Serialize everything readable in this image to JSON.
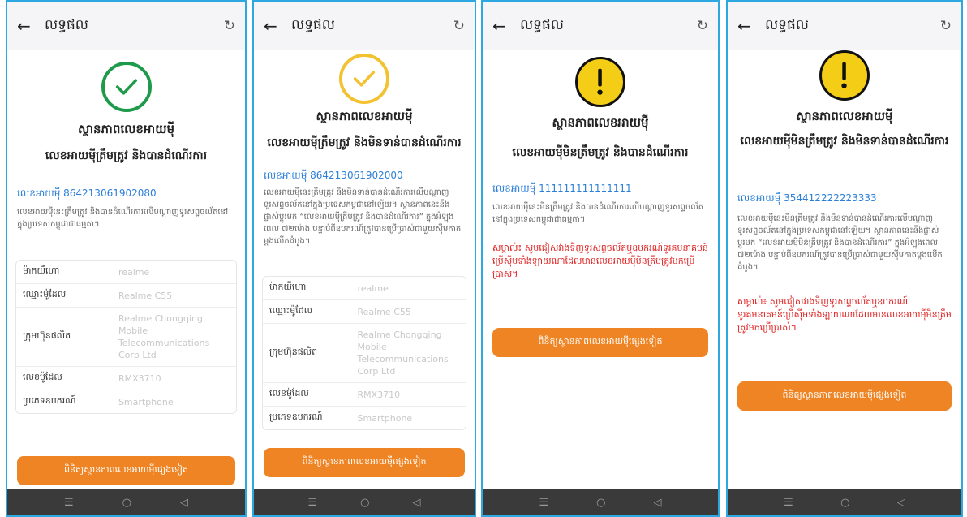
{
  "header_title": "លទ្ធផល",
  "icons": {
    "back": "arrow-left-icon",
    "history": "history-icon",
    "nav_menu": "menu-icon",
    "nav_home": "home-icon",
    "nav_back": "back-triangle-icon"
  },
  "nav": {
    "menu": "☰",
    "home": "○",
    "back": "◁"
  },
  "status_heading": "ស្ថានភាពលេខអាយម៉ី",
  "colors": {
    "accent": "#ee8423",
    "success": "#1e9a4a",
    "pending": "#f2c230",
    "warning": "#f4ce16",
    "link": "#2b7fd8",
    "alert": "#e02020"
  },
  "info_labels": {
    "brand": "ម៉ាកយីហោ",
    "model_name": "ឈ្មោះម៉ូដែល",
    "manufacturer": "ក្រុមហ៊ុនផលិត",
    "model_number": "លេខម៉ូដែល",
    "device_type": "ប្រភេទឧបករណ៍"
  },
  "screens": [
    {
      "result": "លេខអាយម៉ីត្រឹមត្រូវ និងបានដំណើរការ",
      "imei": "លេខអាយម៉ី 864213061902080",
      "description": "លេខអាយម៉ីនេះត្រឹមត្រូវ និងបានដំណើរការលើបណ្តាញទូរសព្ទចល័តនៅក្នុងប្រទេសកម្ពុជាជាធម្មតា។",
      "details": {
        "brand": "realme",
        "model_name": "Realme C55",
        "manufacturer": "Realme Chongqing Mobile Telecommunications Corp Ltd",
        "model_number": "RMX3710",
        "device_type": "Smartphone"
      },
      "button": "ពិនិត្យស្ថានភាពលេខអាយម៉ីផ្សេងទៀត"
    },
    {
      "result": "លេខអាយម៉ីត្រឹមត្រូវ និងមិនទាន់បានដំណើរការ",
      "imei": "លេខអាយម៉ី 864213061902000",
      "description": "លេខអាយម៉ីនេះត្រឹមត្រូវ និងមិនទាន់បានដំណើរការលើបណ្តាញទូរសព្ទចល័តនៅក្នុងប្រទេសកម្ពុជានៅឡើយ។ ស្ថានភាពនេះនឹងផ្លាស់ប្តូរមក “លេខអាយម៉ីត្រឹមត្រូវ និងបានដំណើរការ” ក្នុងអំឡុងពេល ៧២ម៉ោង បន្ទាប់ពីឧបករណ៍ត្រូវបានប្រើប្រាស់ជាមួយស៊ីមកាតម្ដងលើកដំបូង។",
      "details": {
        "brand": "realme",
        "model_name": "Realme C55",
        "manufacturer": "Realme Chongqing Mobile Telecommunications Corp Ltd",
        "model_number": "RMX3710",
        "device_type": "Smartphone"
      },
      "button": "ពិនិត្យស្ថានភាពលេខអាយម៉ីផ្សេងទៀត"
    },
    {
      "result": "លេខអាយម៉ីមិនត្រឹមត្រូវ និងបានដំណើរការ",
      "imei": "លេខអាយម៉ី 111111111111111",
      "description": "លេខអាយម៉ីនេះមិនត្រឹមត្រូវ និងបានដំណើរការលើបណ្តាញទូរសព្ទចល័តនៅក្នុងប្រទេសកម្ពុជាជាធម្មតា។",
      "note": "សម្គាល់៖ សូមជៀសវាងទិញទូរសព្ទចល័តឬឧបករណ៍ទូរគមនាគមន៍ប្រើស៊ីមទាំងឡាយណាដែលមានលេខអាយម៉ីមិនត្រឹមត្រូវមកប្រើប្រាស់។",
      "button": "ពិនិត្យស្ថានភាពលេខអាយម៉ីផ្សេងទៀត"
    },
    {
      "result": "លេខអាយម៉ីមិនត្រឹមត្រូវ និងមិនទាន់បានដំណើរការ",
      "imei": "លេខអាយម៉ី 354412222223333",
      "description": "លេខអាយម៉ីនេះមិនត្រឹមត្រូវ និងមិនទាន់បានដំណើរការលើបណ្តាញទូរសព្ទចល័តនៅក្នុងប្រទេសកម្ពុជានៅឡើយ។ ស្ថានភាពនេះនឹងផ្លាស់ប្តូរមក “លេខអាយម៉ីមិនត្រឹមត្រូវ និងបានដំណើរការ” ក្នុងអំឡុងពេល ៧២ម៉ោង បន្ទាប់ពីឧបករណ៍ត្រូវបានប្រើប្រាស់ជាមួយស៊ីមកាតម្ដងលើកដំបូង។",
      "note": "សម្គាល់៖ សូមជៀសវាងទិញទូរសព្ទចល័តឬឧបករណ៍ទូរគមនាគមន៍ប្រើស៊ីមទាំងឡាយណាដែលមានលេខអាយម៉ីមិនត្រឹមត្រូវមកប្រើប្រាស់។",
      "button": "ពិនិត្យស្ថានភាពលេខអាយម៉ីផ្សេងទៀត"
    }
  ]
}
